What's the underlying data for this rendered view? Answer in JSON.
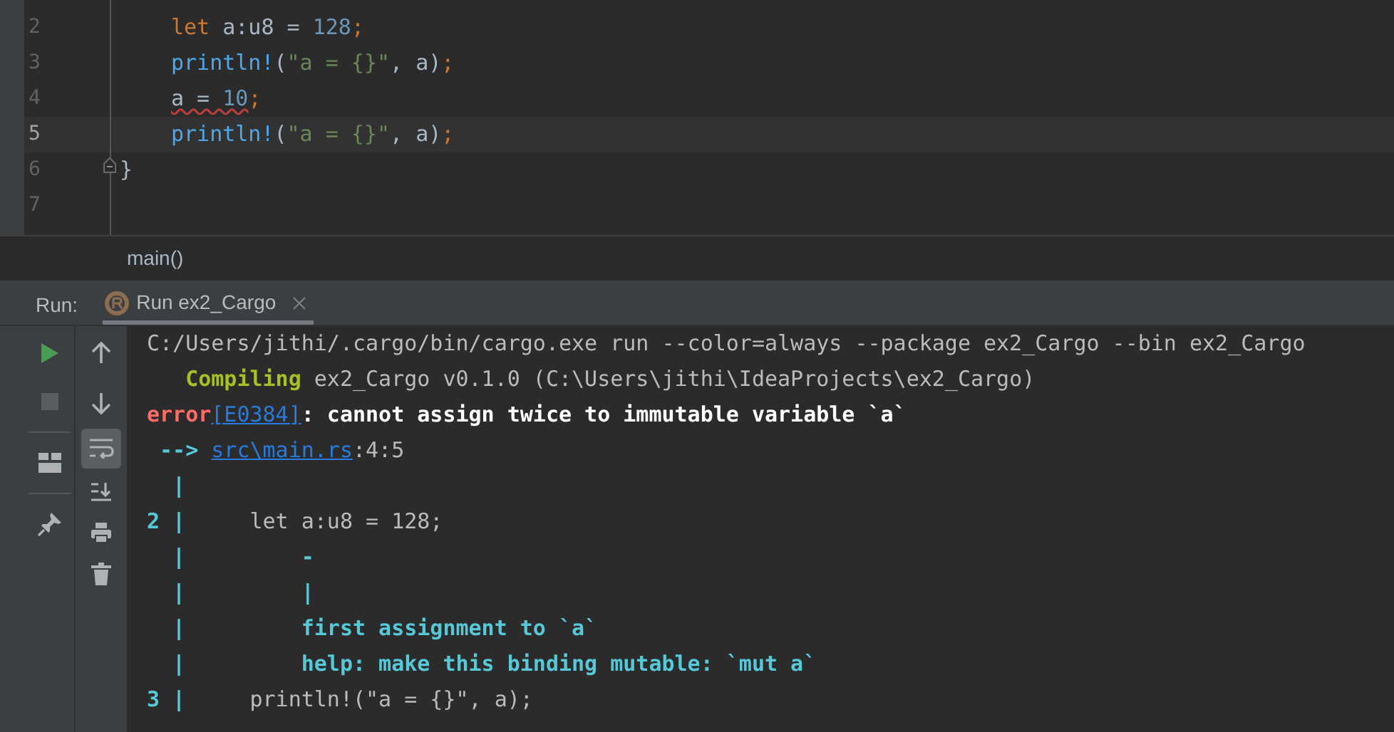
{
  "editor": {
    "lines": [
      {
        "number": "2",
        "current": false,
        "fold": false,
        "indented": true,
        "tokens": [
          {
            "text": "let",
            "kind": "keyword",
            "error": false
          },
          {
            "text": " a:u8 = ",
            "kind": "ident",
            "error": false
          },
          {
            "text": "128",
            "kind": "number",
            "error": false
          },
          {
            "text": ";",
            "kind": "punct",
            "error": false
          }
        ]
      },
      {
        "number": "3",
        "current": false,
        "fold": false,
        "indented": true,
        "tokens": [
          {
            "text": "println!",
            "kind": "macro",
            "error": false
          },
          {
            "text": "(",
            "kind": "ident",
            "error": false
          },
          {
            "text": "\"a = {}\"",
            "kind": "string",
            "error": false
          },
          {
            "text": ", a)",
            "kind": "ident",
            "error": false
          },
          {
            "text": ";",
            "kind": "punct",
            "error": false
          }
        ]
      },
      {
        "number": "4",
        "current": false,
        "fold": false,
        "indented": true,
        "tokens": [
          {
            "text": "a = ",
            "kind": "ident",
            "error": true
          },
          {
            "text": "10",
            "kind": "number",
            "error": true
          },
          {
            "text": ";",
            "kind": "punct",
            "error": false
          }
        ]
      },
      {
        "number": "5",
        "current": true,
        "fold": false,
        "indented": true,
        "tokens": [
          {
            "text": "println!",
            "kind": "macro",
            "error": false
          },
          {
            "text": "(",
            "kind": "ident",
            "error": false
          },
          {
            "text": "\"a = {}\"",
            "kind": "string",
            "error": false
          },
          {
            "text": ", a)",
            "kind": "ident",
            "error": false
          },
          {
            "text": ";",
            "kind": "punct",
            "error": false
          }
        ]
      },
      {
        "number": "6",
        "current": false,
        "fold": true,
        "indented": false,
        "tokens": [
          {
            "text": "}",
            "kind": "ident",
            "error": false
          }
        ]
      },
      {
        "number": "7",
        "current": false,
        "fold": false
      }
    ],
    "breadcrumb": "main()"
  },
  "run_panel": {
    "label": "Run:",
    "tabs": [
      {
        "label": "Run ex2_Cargo",
        "selected": true
      }
    ],
    "toolbar": {
      "stop_disabled": true,
      "soft_wrap_on": true
    },
    "console": [
      [
        {
          "text": "C:/Users/jithi/.cargo/bin/cargo.exe run --color=always --package ex2_Cargo --bin ex2_Cargo",
          "kind": "plain"
        }
      ],
      [
        {
          "text": "   Compiling",
          "kind": "green"
        },
        {
          "text": " ex2_Cargo v0.1.0 (C:\\Users\\jithi\\IdeaProjects\\ex2_Cargo)",
          "kind": "plain"
        }
      ],
      [
        {
          "text": "error",
          "kind": "red"
        },
        {
          "text": "[E0384]",
          "kind": "link"
        },
        {
          "text": ": cannot assign twice to immutable variable `a`",
          "kind": "bold"
        }
      ],
      [
        {
          "text": " --> ",
          "kind": "cyan"
        },
        {
          "text": "src\\main.rs",
          "kind": "link"
        },
        {
          "text": ":4:5",
          "kind": "plain"
        }
      ],
      [
        {
          "text": "  |",
          "kind": "cyan"
        }
      ],
      [
        {
          "text": "2 |",
          "kind": "cyan"
        },
        {
          "text": "     let a:u8 = 128;",
          "kind": "plain"
        }
      ],
      [
        {
          "text": "  |",
          "kind": "cyan"
        },
        {
          "text": "         -",
          "kind": "cyan"
        }
      ],
      [
        {
          "text": "  |",
          "kind": "cyan"
        },
        {
          "text": "         |",
          "kind": "cyan"
        }
      ],
      [
        {
          "text": "  |",
          "kind": "cyan"
        },
        {
          "text": "         first assignment to `a`",
          "kind": "cyan"
        }
      ],
      [
        {
          "text": "  |",
          "kind": "cyan"
        },
        {
          "text": "         help: make this binding mutable: `mut a`",
          "kind": "cyan"
        }
      ],
      [
        {
          "text": "3 |",
          "kind": "cyan"
        },
        {
          "text": "     println!(\"a = {}\", a);",
          "kind": "plain"
        }
      ]
    ]
  }
}
